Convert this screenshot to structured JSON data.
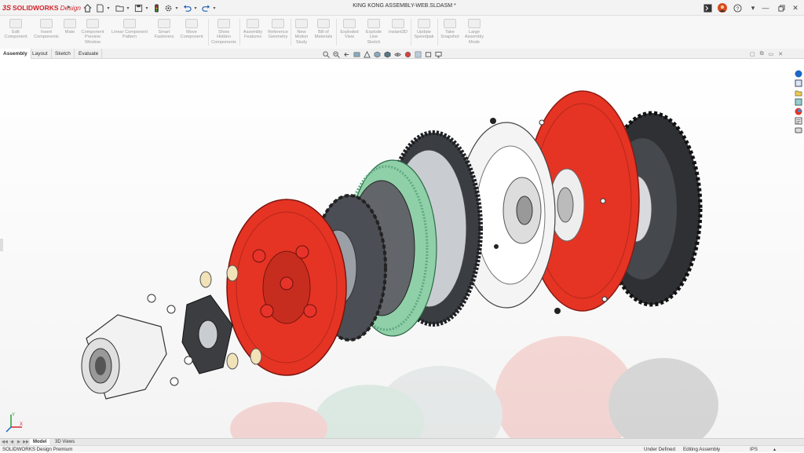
{
  "titlebar": {
    "logo_ds": "3S",
    "logo_brand": "SOLIDWORKS",
    "logo_product": "Design",
    "document_title": "KING KONG ASSEMBLY-WEB.SLDASM *",
    "quick_access_icons": [
      "home-icon",
      "new-document-icon",
      "open-icon",
      "save-icon",
      "print-icon",
      "options-icon",
      "undo-icon",
      "redo-icon"
    ],
    "window_controls": [
      "command-search-icon",
      "user-avatar",
      "help-icon",
      "minimize-icon",
      "restore-icon",
      "close-icon"
    ]
  },
  "command_manager": {
    "items": [
      {
        "label": "Edit\nComponent"
      },
      {
        "label": "Insert\nComponents"
      },
      {
        "label": "Mate"
      },
      {
        "label": "Component\nPreview\nWindow"
      },
      {
        "label": "Linear Component\nPattern"
      },
      {
        "label": "Smart\nFasteners"
      },
      {
        "label": "Move\nComponent"
      },
      {
        "label": "Show\nHidden\nComponents"
      },
      {
        "label": "Assembly\nFeatures"
      },
      {
        "label": "Reference\nGeometry"
      },
      {
        "label": "New\nMotion\nStudy"
      },
      {
        "label": "Bill of\nMaterials"
      },
      {
        "label": "Exploded\nView"
      },
      {
        "label": "Explode\nLine\nSketch"
      },
      {
        "label": "Instant3D"
      },
      {
        "label": "Update\nSpeedpak"
      },
      {
        "label": "Take\nSnapshot"
      },
      {
        "label": "Large\nAssembly\nMode"
      }
    ]
  },
  "tabs": [
    {
      "label": "Assembly",
      "active": true
    },
    {
      "label": "Layout",
      "active": false
    },
    {
      "label": "Sketch",
      "active": false
    },
    {
      "label": "Evaluate",
      "active": false
    }
  ],
  "view_toolbar_icons": [
    "zoom-to-fit-icon",
    "zoom-area-icon",
    "previous-view-icon",
    "section-view-icon",
    "dynamic-annotation-icon",
    "view-orientation-icon",
    "display-style-icon",
    "hide-show-icon",
    "edit-appearance-icon",
    "apply-scene-icon",
    "view-settings-icon",
    "display-monitor-icon"
  ],
  "viewport_controls": [
    "restore-viewport-icon",
    "tile-icon",
    "minimize-viewport-icon",
    "close-viewport-icon"
  ],
  "task_pane_icons": [
    "resources-icon",
    "design-library-icon",
    "file-explorer-icon",
    "view-palette-icon",
    "appearances-icon",
    "custom-properties-icon",
    "solidworks-forum-icon"
  ],
  "model_tabs": [
    {
      "label": "Model",
      "active": true
    },
    {
      "label": "3D Views",
      "active": false
    }
  ],
  "statusbar": {
    "product": "SOLIDWORKS Design Premium",
    "state": "Under Defined",
    "mode": "Editing Assembly",
    "units": "IPS"
  },
  "colors": {
    "accent_red": "#e53424",
    "spring_red": "#e8332a",
    "friction_green": "#5ea882",
    "metal_dark": "#3a3d42",
    "metal_light": "#c9cdd2"
  }
}
